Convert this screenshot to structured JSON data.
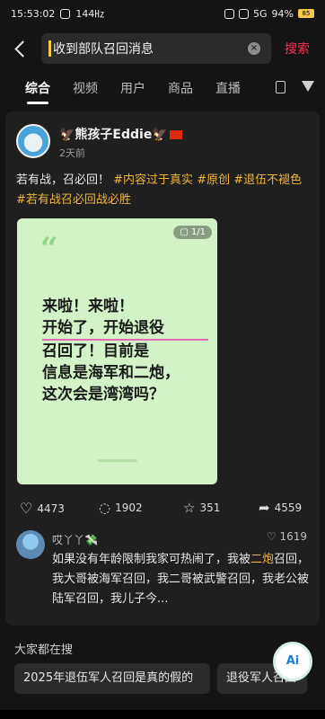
{
  "status_bar": {
    "time": "15:53:02",
    "fps": "144㎐",
    "signal": "5G",
    "battery": "94%",
    "battery_badge": "85"
  },
  "search": {
    "query": "收到部队召回消息",
    "button": "搜索"
  },
  "tabs": [
    "综合",
    "视频",
    "用户",
    "商品",
    "直播"
  ],
  "post": {
    "author": "🦅熊孩子Eddie🦅",
    "time": "2天前",
    "text_plain": "若有战，召必回！",
    "tags": [
      "#内容过于真实",
      "#原创",
      "#退伍不褪色",
      "#若有战召必回战必胜"
    ],
    "image_badge": "1/1",
    "image_lines": [
      "来啦！来啦！",
      "开始了，开始退役",
      "召回了！目前是",
      "信息是海军和二炮，",
      "这次会是湾湾吗？"
    ],
    "likes": "4473",
    "comments": "1902",
    "favorites": "351",
    "shares": "4559"
  },
  "comment": {
    "name": "哎丫丫💸",
    "likes": "1619",
    "text_before": "如果没有年龄限制我家可热闹了，我被",
    "keyword": "二炮",
    "text_after": "召回，我大哥被海军召回，我二哥被武警召回，我老公被陆军召回，我儿子今..."
  },
  "hot_searches": {
    "title": "大家都在搜",
    "items": [
      "2025年退伍军人召回是真的假的",
      "退役军人召回"
    ]
  },
  "ai_button": "Ai"
}
